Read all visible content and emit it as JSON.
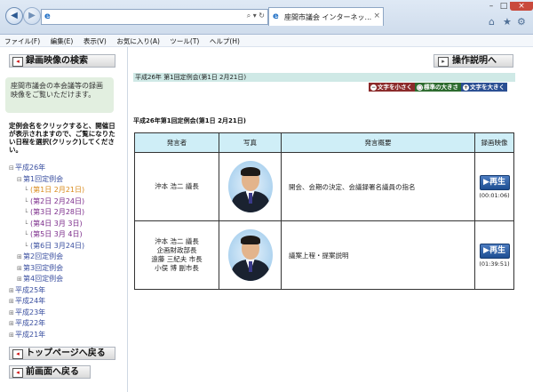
{
  "browser": {
    "address_value": "",
    "tab_label": "座間市議会 インターネッ...",
    "menu": [
      "ファイル(F)",
      "編集(E)",
      "表示(V)",
      "お気に入り(A)",
      "ツール(T)",
      "ヘルプ(H)"
    ]
  },
  "sidebar": {
    "search_button": "録画映像の検索",
    "note": "座間市議会の本会議等の録画映像をご覧いただけます。",
    "hint": "定例会名をクリックすると、開催日が表示されますので、ご覧になりたい日程を選択(クリック)してください。",
    "tree": [
      {
        "label": "平成26年",
        "level": 0,
        "exp": "⊟"
      },
      {
        "label": "第1回定例会",
        "level": 1,
        "exp": "⊟"
      },
      {
        "label": "(第1日 2月21日)",
        "level": 2,
        "exp": "└"
      },
      {
        "label": "(第2日 2月24日)",
        "level": 2,
        "exp": "└"
      },
      {
        "label": "(第3日 2月28日)",
        "level": 2,
        "exp": "└"
      },
      {
        "label": "(第4日 3月 3日)",
        "level": 2,
        "exp": "└"
      },
      {
        "label": "(第5日 3月 4日)",
        "level": 2,
        "exp": "└"
      },
      {
        "label": "(第6日 3月24日)",
        "level": 2,
        "exp": "└"
      },
      {
        "label": "第2回定例会",
        "level": 1,
        "exp": "⊞"
      },
      {
        "label": "第3回定例会",
        "level": 1,
        "exp": "⊞"
      },
      {
        "label": "第4回定例会",
        "level": 1,
        "exp": "⊞"
      },
      {
        "label": "平成25年",
        "level": 0,
        "exp": "⊞"
      },
      {
        "label": "平成24年",
        "level": 0,
        "exp": "⊞"
      },
      {
        "label": "平成23年",
        "level": 0,
        "exp": "⊞"
      },
      {
        "label": "平成22年",
        "level": 0,
        "exp": "⊞"
      },
      {
        "label": "平成21年",
        "level": 0,
        "exp": "⊞"
      }
    ],
    "top_button": "トップページへ戻る",
    "back_button": "前画面へ戻る"
  },
  "main": {
    "help_button": "操作説明へ",
    "session_header": "平成26年 第1回定例会(第1日 2月21日)",
    "font_controls": {
      "small": "文字を小さく",
      "standard": "標準の大きさ",
      "large": "文字を大きく"
    },
    "subtitle": "平成26年第1回定例会(第1日 2月21日)",
    "table": {
      "headers": [
        "発言者",
        "写真",
        "発言概要",
        "録画映像"
      ],
      "rows": [
        {
          "speakers": [
            "沖本 浩二 議長"
          ],
          "summary": "開会、会期の決定、会議録署名議員の指名",
          "play": "再生",
          "duration": "(00:01:06)"
        },
        {
          "speakers": [
            "沖本 浩二 議長",
            "企画財政部長",
            "遠藤 三紀夫 市長",
            "小俣 博 副市長"
          ],
          "summary": "議案上程・提案説明",
          "play": "再生",
          "duration": "(01:39:51)"
        }
      ]
    }
  }
}
